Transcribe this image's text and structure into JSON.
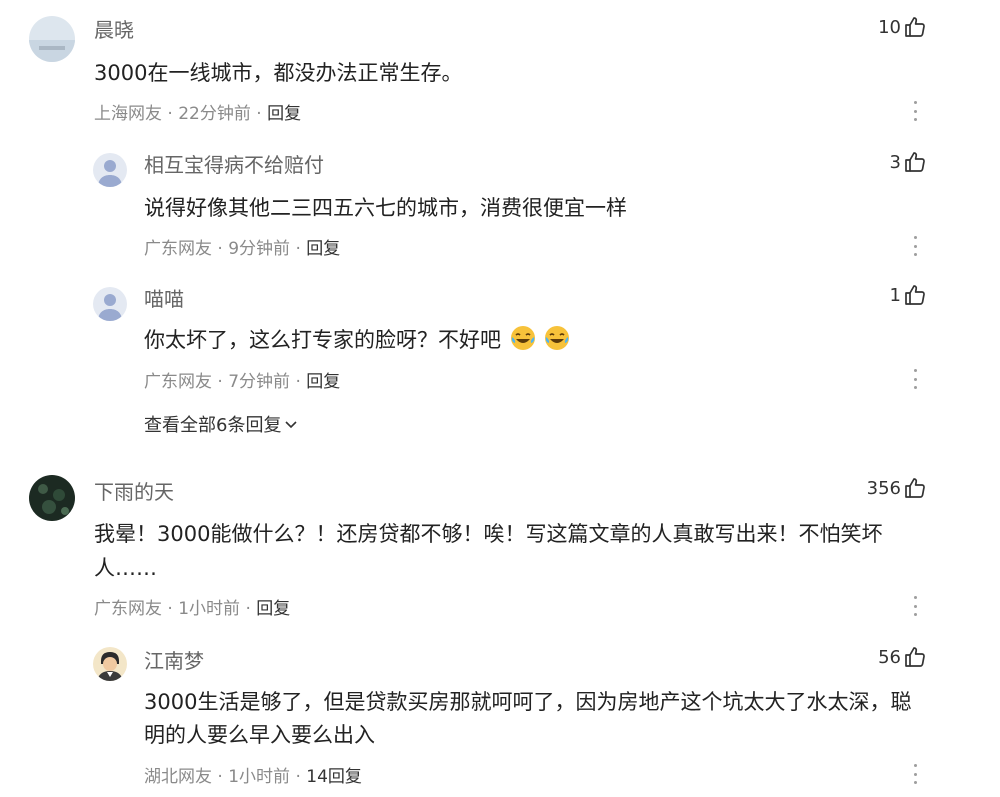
{
  "comments": [
    {
      "user": "晨晓",
      "likes": "10",
      "text": "3000在一线城市，都没办法正常生存。",
      "location": "上海网友",
      "time": "22分钟前",
      "reply_label": "回复",
      "replies": [
        {
          "user": "相互宝得病不给赔付",
          "likes": "3",
          "text": "说得好像其他二三四五六七的城市，消费很便宜一样",
          "location": "广东网友",
          "time": "9分钟前",
          "reply_label": "回复"
        },
        {
          "user": "喵喵",
          "likes": "1",
          "text": "你太坏了，这么打专家的脸呀？不好吧",
          "location": "广东网友",
          "time": "7分钟前",
          "reply_label": "回复"
        }
      ],
      "view_all": "查看全部6条回复"
    },
    {
      "user": "下雨的天",
      "likes": "356",
      "text_line1": "我晕！3000能做什么？！还房贷都不够！唉！写这篇文章的人真敢写出来！不怕笑坏",
      "text_line2": "人……",
      "location": "广东网友",
      "time": "1小时前",
      "reply_label": "回复",
      "replies": [
        {
          "user": "江南梦",
          "likes": "56",
          "text_line1": "3000生活是够了，但是贷款买房那就呵呵了，因为房地产这个坑太大了水太深，聪",
          "text_line2": "明的人要么早入要么出入",
          "location": "湖北网友",
          "time": "1小时前",
          "reply_label": "14回复"
        }
      ]
    }
  ],
  "separator": " · ",
  "icons": {
    "like": "thumbs-up-icon",
    "more": "more-vertical-icon",
    "expand": "chevron-down-icon",
    "emoji": "laughing-tears-emoji"
  },
  "colors": {
    "text": "#222222",
    "name": "#666666",
    "meta": "#8a8a8a",
    "emoji": "#f7c23a"
  }
}
